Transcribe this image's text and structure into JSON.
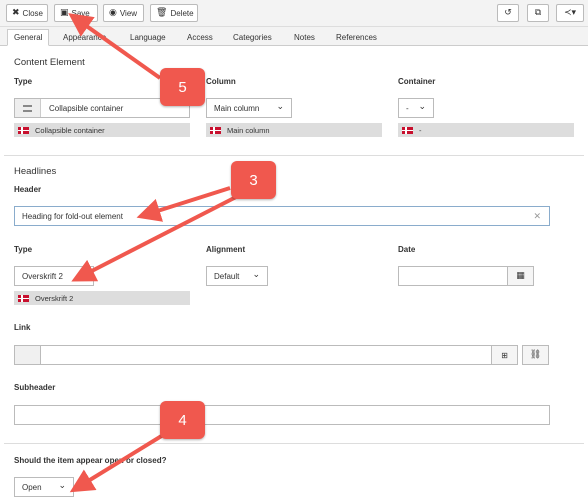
{
  "toolbar": {
    "close_label": "Close",
    "save_label": "Save",
    "view_label": "View",
    "delete_label": "Delete"
  },
  "tabs": [
    {
      "label": "General"
    },
    {
      "label": "Appearance"
    },
    {
      "label": "Language"
    },
    {
      "label": "Access"
    },
    {
      "label": "Categories"
    },
    {
      "label": "Notes"
    },
    {
      "label": "References"
    }
  ],
  "content_element": {
    "section_title": "Content Element",
    "type_label": "Type",
    "type_value": "Collapsible container",
    "type_hint": "Collapsible container",
    "column_label": "Column",
    "column_value": "Main column",
    "column_hint": "Main column",
    "container_label": "Container",
    "container_value": "-",
    "container_hint": "-"
  },
  "headlines": {
    "section_title": "Headlines",
    "header_label": "Header",
    "header_value": "Heading for fold-out element",
    "type_label": "Type",
    "type_value": "Overskrift 2",
    "type_hint": "Overskrift 2",
    "alignment_label": "Alignment",
    "alignment_value": "Default",
    "date_label": "Date",
    "date_value": "",
    "link_label": "Link",
    "link_value": "",
    "subheader_label": "Subheader",
    "subheader_value": ""
  },
  "open_closed": {
    "question": "Should the item appear open or closed?",
    "value": "Open"
  },
  "callouts": {
    "c5": "5",
    "c3": "3",
    "c4": "4"
  },
  "colors": {
    "callout": "#f0584e",
    "flag": "#c8102e"
  }
}
